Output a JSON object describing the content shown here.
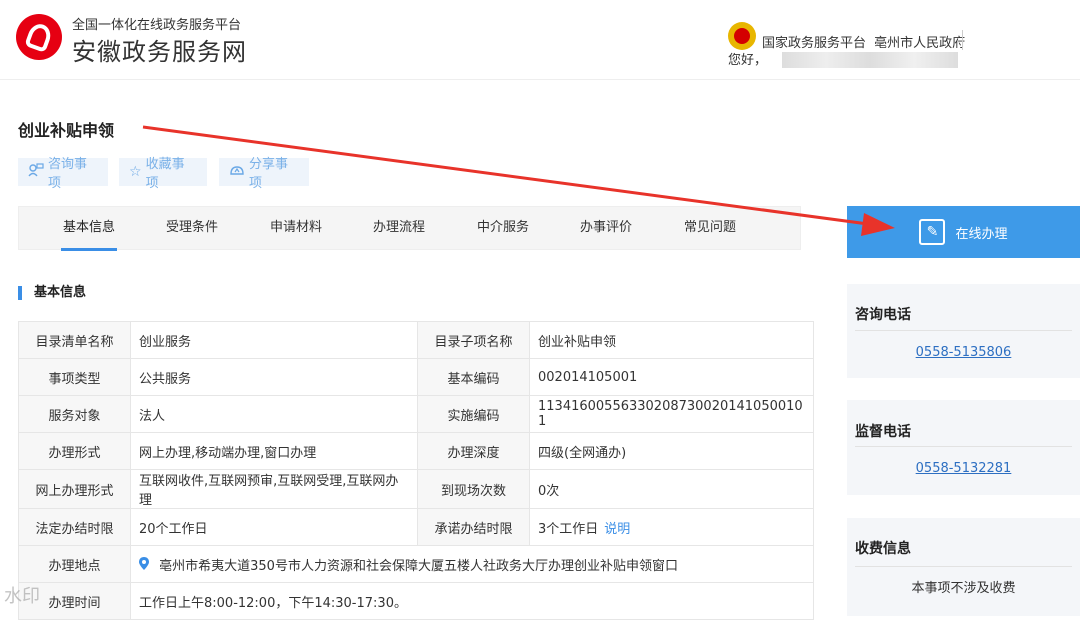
{
  "header": {
    "site_subtitle": "全国一体化在线政务服务平台",
    "site_title": "安徽政务服务网",
    "portal_link_1": "国家政务服务平台",
    "portal_link_2": "亳州市人民政府",
    "greeting": "您好，"
  },
  "page": {
    "title": "创业补贴申领",
    "actions": [
      {
        "icon": "person-chat-icon",
        "label": "咨询事项"
      },
      {
        "icon": "star-icon",
        "label": "收藏事项"
      },
      {
        "icon": "share-icon",
        "label": "分享事项"
      }
    ],
    "tabs": [
      "基本信息",
      "受理条件",
      "申请材料",
      "办理流程",
      "中介服务",
      "办事评价",
      "常见问题"
    ],
    "active_tab": "基本信息",
    "section_title": "基本信息"
  },
  "info_table": {
    "rows": [
      {
        "l1": "目录清单名称",
        "v1": "创业服务",
        "l2": "目录子项名称",
        "v2": "创业补贴申领"
      },
      {
        "l1": "事项类型",
        "v1": "公共服务",
        "l2": "基本编码",
        "v2": "002014105001"
      },
      {
        "l1": "服务对象",
        "v1": "法人",
        "l2": "实施编码",
        "v2": "11341600556330208730020141050010​1"
      },
      {
        "l1": "办理形式",
        "v1": "网上办理,移动端办理,窗口办理",
        "l2": "办理深度",
        "v2": "四级(全网通办)"
      },
      {
        "l1": "网上办理形式",
        "v1": "互联网收件,互联网预审,互联网受理,互联网办理",
        "l2": "到现场次数",
        "v2": "0次"
      },
      {
        "l1": "法定办结时限",
        "v1": "20个工作日",
        "l2": "承诺办结时限",
        "v2": "3个工作日"
      }
    ],
    "explain_link": "说明",
    "address_label": "办理地点",
    "address_value": "亳州市希夷大道350号市人力资源和社会保障大厦五楼人社政务大厅办理创业补贴申领窗口",
    "time_label": "办理时间",
    "time_value": "工作日上午8:00-12:00，下午14:30-17:30。"
  },
  "sidebar": {
    "online_button": "在线办理",
    "consult_title": "咨询电话",
    "consult_phone": "0558-5135806",
    "supervise_title": "监督电话",
    "supervise_phone": "0558-5132281",
    "fee_title": "收费信息",
    "fee_note": "本事项不涉及收费"
  },
  "colors": {
    "accent": "#3e9ae8",
    "arrow": "#e8332a",
    "logo": "#e60012"
  },
  "watermark": "水印"
}
